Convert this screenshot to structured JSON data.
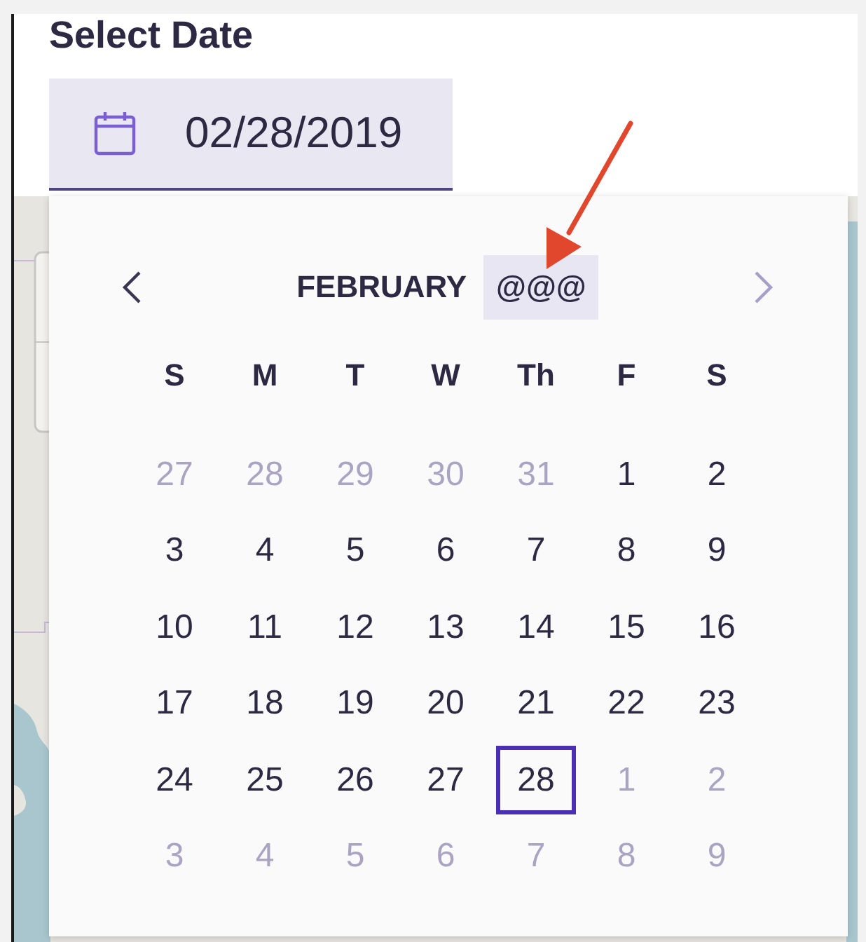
{
  "background": {
    "kind": "map"
  },
  "date_field": {
    "label": "Select Date",
    "value": "02/28/2019"
  },
  "calendar": {
    "prev_button": {
      "disabled": false
    },
    "next_button": {
      "disabled": true
    },
    "month": "FEBRUARY",
    "year": {
      "text": "@@@",
      "highlighted": true
    },
    "weekdays": [
      "S",
      "M",
      "T",
      "W",
      "Th",
      "F",
      "S"
    ],
    "weeks": [
      [
        {
          "day": "27",
          "outside_month": true,
          "selected": false
        },
        {
          "day": "28",
          "outside_month": true,
          "selected": false
        },
        {
          "day": "29",
          "outside_month": true,
          "selected": false
        },
        {
          "day": "30",
          "outside_month": true,
          "selected": false
        },
        {
          "day": "31",
          "outside_month": true,
          "selected": false
        },
        {
          "day": "1",
          "outside_month": false,
          "selected": false
        },
        {
          "day": "2",
          "outside_month": false,
          "selected": false
        }
      ],
      [
        {
          "day": "3",
          "outside_month": false,
          "selected": false
        },
        {
          "day": "4",
          "outside_month": false,
          "selected": false
        },
        {
          "day": "5",
          "outside_month": false,
          "selected": false
        },
        {
          "day": "6",
          "outside_month": false,
          "selected": false
        },
        {
          "day": "7",
          "outside_month": false,
          "selected": false
        },
        {
          "day": "8",
          "outside_month": false,
          "selected": false
        },
        {
          "day": "9",
          "outside_month": false,
          "selected": false
        }
      ],
      [
        {
          "day": "10",
          "outside_month": false,
          "selected": false
        },
        {
          "day": "11",
          "outside_month": false,
          "selected": false
        },
        {
          "day": "12",
          "outside_month": false,
          "selected": false
        },
        {
          "day": "13",
          "outside_month": false,
          "selected": false
        },
        {
          "day": "14",
          "outside_month": false,
          "selected": false
        },
        {
          "day": "15",
          "outside_month": false,
          "selected": false
        },
        {
          "day": "16",
          "outside_month": false,
          "selected": false
        }
      ],
      [
        {
          "day": "17",
          "outside_month": false,
          "selected": false
        },
        {
          "day": "18",
          "outside_month": false,
          "selected": false
        },
        {
          "day": "19",
          "outside_month": false,
          "selected": false
        },
        {
          "day": "20",
          "outside_month": false,
          "selected": false
        },
        {
          "day": "21",
          "outside_month": false,
          "selected": false
        },
        {
          "day": "22",
          "outside_month": false,
          "selected": false
        },
        {
          "day": "23",
          "outside_month": false,
          "selected": false
        }
      ],
      [
        {
          "day": "24",
          "outside_month": false,
          "selected": false
        },
        {
          "day": "25",
          "outside_month": false,
          "selected": false
        },
        {
          "day": "26",
          "outside_month": false,
          "selected": false
        },
        {
          "day": "27",
          "outside_month": false,
          "selected": false
        },
        {
          "day": "28",
          "outside_month": false,
          "selected": true
        },
        {
          "day": "1",
          "outside_month": true,
          "selected": false
        },
        {
          "day": "2",
          "outside_month": true,
          "selected": false
        }
      ],
      [
        {
          "day": "3",
          "outside_month": true,
          "selected": false
        },
        {
          "day": "4",
          "outside_month": true,
          "selected": false
        },
        {
          "day": "5",
          "outside_month": true,
          "selected": false
        },
        {
          "day": "6",
          "outside_month": true,
          "selected": false
        },
        {
          "day": "7",
          "outside_month": true,
          "selected": false
        },
        {
          "day": "8",
          "outside_month": true,
          "selected": false
        },
        {
          "day": "9",
          "outside_month": true,
          "selected": false
        }
      ]
    ]
  },
  "annotations": [
    {
      "kind": "arrow"
    }
  ]
}
